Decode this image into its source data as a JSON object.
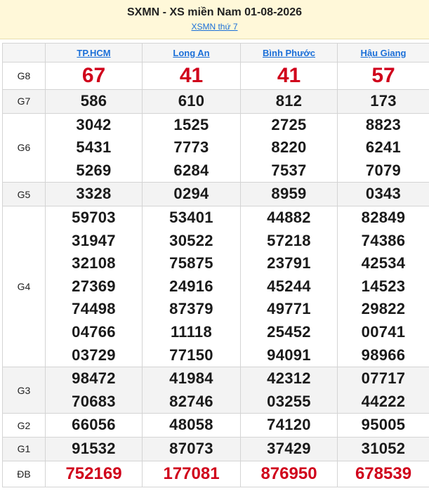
{
  "header": {
    "title": "SXMN - XS miền Nam 01-08-2026",
    "subtitle": "XSMN thứ 7"
  },
  "provinces": [
    "TP.HCM",
    "Long An",
    "Bình Phước",
    "Hậu Giang"
  ],
  "prizes": [
    {
      "label": "G8",
      "style": "g8",
      "values": [
        [
          "67"
        ],
        [
          "41"
        ],
        [
          "41"
        ],
        [
          "57"
        ]
      ]
    },
    {
      "label": "G7",
      "style": "alt",
      "values": [
        [
          "586"
        ],
        [
          "610"
        ],
        [
          "812"
        ],
        [
          "173"
        ]
      ]
    },
    {
      "label": "G6",
      "style": "normal",
      "values": [
        [
          "3042",
          "5431",
          "5269"
        ],
        [
          "1525",
          "7773",
          "6284"
        ],
        [
          "2725",
          "8220",
          "7537"
        ],
        [
          "8823",
          "6241",
          "7079"
        ]
      ]
    },
    {
      "label": "G5",
      "style": "alt",
      "values": [
        [
          "3328"
        ],
        [
          "0294"
        ],
        [
          "8959"
        ],
        [
          "0343"
        ]
      ]
    },
    {
      "label": "G4",
      "style": "normal",
      "values": [
        [
          "59703",
          "31947",
          "32108",
          "27369",
          "74498",
          "04766",
          "03729"
        ],
        [
          "53401",
          "30522",
          "75875",
          "24916",
          "87379",
          "11118",
          "77150"
        ],
        [
          "44882",
          "57218",
          "23791",
          "45244",
          "49771",
          "25452",
          "94091"
        ],
        [
          "82849",
          "74386",
          "42534",
          "14523",
          "29822",
          "00741",
          "98966"
        ]
      ]
    },
    {
      "label": "G3",
      "style": "alt",
      "values": [
        [
          "98472",
          "70683"
        ],
        [
          "41984",
          "82746"
        ],
        [
          "42312",
          "03255"
        ],
        [
          "07717",
          "44222"
        ]
      ]
    },
    {
      "label": "G2",
      "style": "normal",
      "values": [
        [
          "66056"
        ],
        [
          "48058"
        ],
        [
          "74120"
        ],
        [
          "95005"
        ]
      ]
    },
    {
      "label": "G1",
      "style": "alt",
      "values": [
        [
          "91532"
        ],
        [
          "87073"
        ],
        [
          "37429"
        ],
        [
          "31052"
        ]
      ]
    },
    {
      "label": "ĐB",
      "style": "db",
      "values": [
        [
          "752169"
        ],
        [
          "177081"
        ],
        [
          "876950"
        ],
        [
          "678539"
        ]
      ]
    }
  ]
}
